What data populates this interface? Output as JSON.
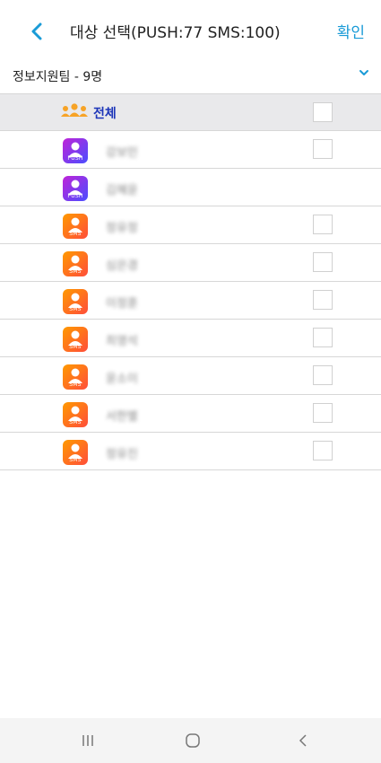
{
  "header": {
    "title": "대상 선택(PUSH:77 SMS:100)",
    "confirm_label": "확인",
    "back_icon": "chevron-left-icon",
    "accent_color": "#1a9bd7"
  },
  "group": {
    "label": "정보지원팀 - 9명",
    "toggle_icon": "chevron-down-icon"
  },
  "all_row": {
    "label": "전체",
    "icon": "group-icon"
  },
  "members": [
    {
      "name": "강보민",
      "type": "PUSH",
      "has_checkbox": true
    },
    {
      "name": "김혜윤",
      "type": "PUSH",
      "has_checkbox": false
    },
    {
      "name": "정유정",
      "type": "SMS",
      "has_checkbox": true
    },
    {
      "name": "심은경",
      "type": "SMS",
      "has_checkbox": true
    },
    {
      "name": "이정훈",
      "type": "SMS",
      "has_checkbox": true
    },
    {
      "name": "최영석",
      "type": "SMS",
      "has_checkbox": true
    },
    {
      "name": "윤소이",
      "type": "SMS",
      "has_checkbox": true
    },
    {
      "name": "서한별",
      "type": "SMS",
      "has_checkbox": true
    },
    {
      "name": "정유진",
      "type": "SMS",
      "has_checkbox": true
    }
  ],
  "navbar": {
    "recent_icon": "recent-apps-icon",
    "home_icon": "home-icon",
    "back_icon": "back-icon"
  }
}
